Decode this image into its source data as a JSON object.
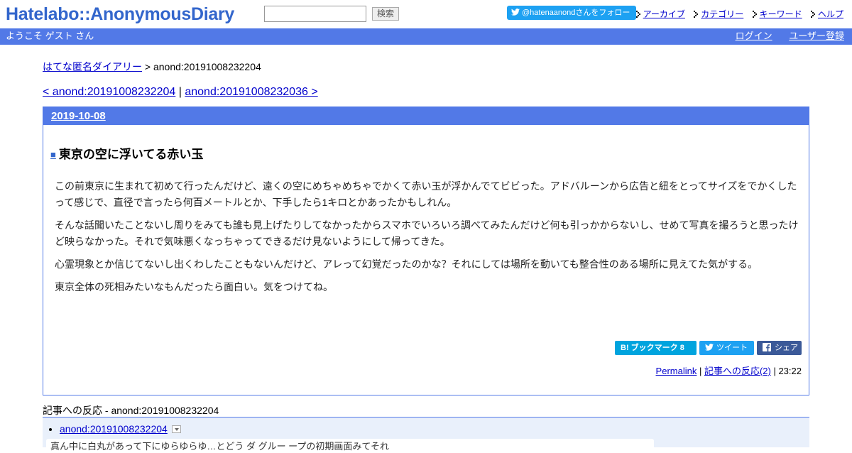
{
  "header": {
    "logo": "Hatelabo::AnonymousDiary",
    "search_button": "検索",
    "follow": "@hatenaanondさんをフォロー",
    "links": [
      "アーカイブ",
      "カテゴリー",
      "キーワード",
      "ヘルプ"
    ]
  },
  "welcome": {
    "text": "ようこそ ゲスト さん",
    "login": "ログイン",
    "register": "ユーザー登録"
  },
  "breadcrumb": {
    "home": "はてな匿名ダイアリー",
    "sep": " > ",
    "current": "anond:20191008232204"
  },
  "pager": {
    "prev": "< anond:20191008232204",
    "sep": " | ",
    "next": "anond:20191008232036 >"
  },
  "entry": {
    "date": "2019-10-08",
    "square": "■",
    "title": "東京の空に浮いてる赤い玉",
    "paragraphs": [
      "この前東京に生まれて初めて行ったんだけど、遠くの空にめちゃめちゃでかくて赤い玉が浮かんでてビビった。アドバルーンから広告と紐をとってサイズをでかくしたって感じで、直径で言ったら何百メートルとか、下手したら1キロとかあったかもしれん。",
      "そんな話聞いたことないし周りをみても誰も見上げたりしてなかったからスマホでいろいろ調べてみたんだけど何も引っかからないし、せめて写真を撮ろうと思ったけど映らなかった。それで気味悪くなっちゃってできるだけ見ないようにして帰ってきた。",
      "心霊現象とか信じてないし出くわしたこともないんだけど、アレって幻覚だったのかな？それにしては場所を動いても整合性のある場所に見えてた気がする。",
      "東京全体の死相みたいなもんだったら面白い。気をつけてね。"
    ],
    "bookmark": "B! ブックマーク  8",
    "tweet": "ツイート",
    "share": "シェア",
    "permalink": "Permalink",
    "reactions_link": "記事への反応(2)",
    "time": "23:22"
  },
  "reactions": {
    "title": "記事への反応 - anond:20191008232204",
    "items": [
      {
        "link": "anond:20191008232204",
        "excerpt": "真ん中に白丸があって下にゆらゆらゆ…とどう ダ グルー ープの初期画面みてそれ"
      }
    ]
  }
}
